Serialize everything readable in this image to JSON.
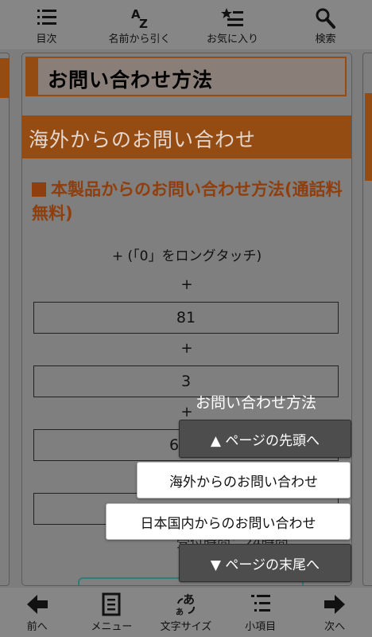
{
  "top_toolbar": {
    "items": [
      {
        "label": "目次",
        "icon": "list-icon"
      },
      {
        "label": "名前から引く",
        "icon": "az-sort-icon",
        "glyph": "AZ"
      },
      {
        "label": "お気に入り",
        "icon": "star-list-icon"
      },
      {
        "label": "検索",
        "icon": "search-icon"
      }
    ]
  },
  "page": {
    "title": "お問い合わせ方法",
    "section": "海外からのお問い合わせ",
    "subheading": "本製品からのお問い合わせ方法(通話料無料)",
    "instruction": "+ (「0」をロングタッチ)",
    "plus": "+",
    "numbers": [
      "81",
      "3",
      "66"
    ],
    "obscured_text": "受付時間：24時間"
  },
  "popup": {
    "title": "お問い合わせ方法",
    "to_top": "▲ ページの先頭へ",
    "overseas": "海外からのお問い合わせ",
    "domestic": "日本国内からのお問い合わせ",
    "to_bottom": "▼ ページの末尾へ"
  },
  "bottom_toolbar": {
    "items": [
      {
        "label": "前へ",
        "icon": "arrow-left-icon"
      },
      {
        "label": "メニュー",
        "icon": "menu-document-icon"
      },
      {
        "label": "文字サイズ",
        "icon": "text-size-icon",
        "glyph_large": "あ",
        "glyph_small": "あ"
      },
      {
        "label": "小項目",
        "icon": "sub-list-icon"
      },
      {
        "label": "次へ",
        "icon": "arrow-right-icon"
      }
    ]
  },
  "colors": {
    "accent": "#944c12",
    "subhead": "#8f3e0c",
    "background": "#7f7f7f",
    "toolbar": "#868686"
  }
}
